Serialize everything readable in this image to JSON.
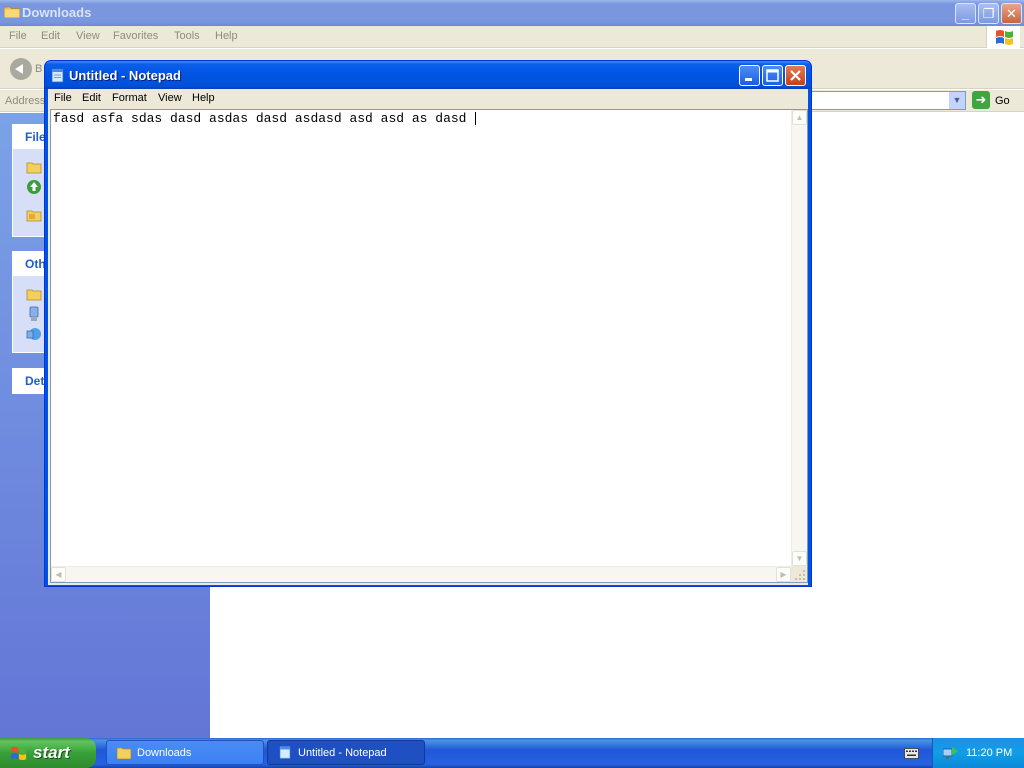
{
  "explorer": {
    "title": "Downloads",
    "menu": [
      "File",
      "Edit",
      "View",
      "Favorites",
      "Tools",
      "Help"
    ],
    "back_partial": "B",
    "address_label": "Address",
    "go_label": "Go",
    "task_boxes": [
      {
        "heading": "File"
      },
      {
        "heading": "Oth"
      },
      {
        "heading": "Det"
      }
    ]
  },
  "notepad": {
    "title": "Untitled - Notepad",
    "menu": [
      "File",
      "Edit",
      "Format",
      "View",
      "Help"
    ],
    "content": "fasd asfa sdas dasd asdas dasd asdasd asd asd as dasd "
  },
  "taskbar": {
    "start_label": "start",
    "buttons": [
      {
        "label": "Downloads",
        "icon": "folder-icon",
        "active": false
      },
      {
        "label": "Untitled - Notepad",
        "icon": "notepad-icon",
        "active": true
      }
    ],
    "clock": "11:20 PM"
  },
  "colors": {
    "title_active": "#0054e3",
    "title_inactive": "#7a96df",
    "taskbar": "#2157d7",
    "start_green": "#37a137",
    "left_pane": "#6375d6"
  }
}
